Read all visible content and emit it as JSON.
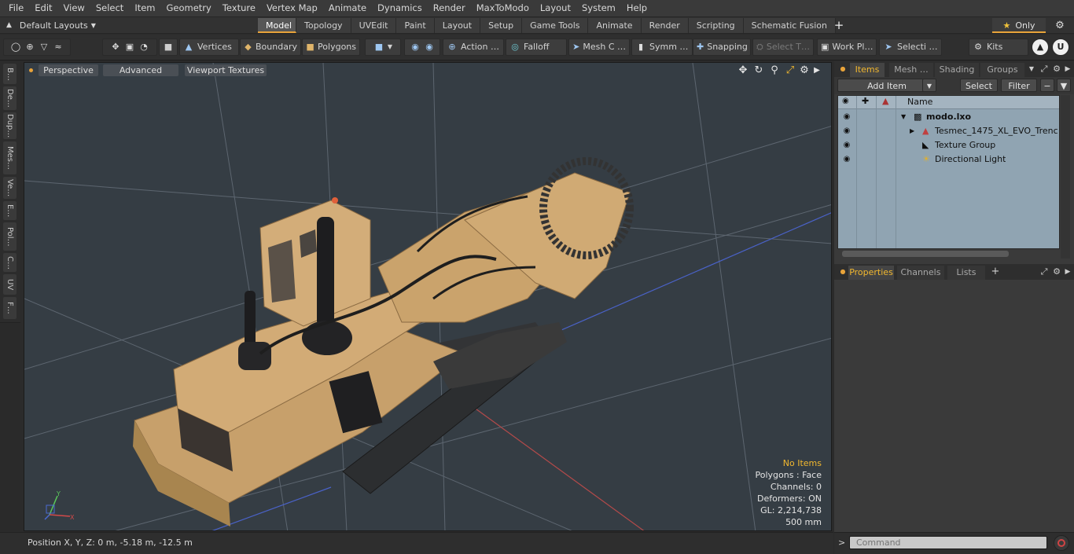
{
  "menu": [
    "File",
    "Edit",
    "View",
    "Select",
    "Item",
    "Geometry",
    "Texture",
    "Vertex Map",
    "Animate",
    "Dynamics",
    "Render",
    "MaxToModo",
    "Layout",
    "System",
    "Help"
  ],
  "layout_dropdown": "Default Layouts",
  "layout_tabs": [
    "Model",
    "Topology",
    "UVEdit",
    "Paint",
    "Layout",
    "Setup",
    "Game Tools",
    "Animate",
    "Render",
    "Scripting",
    "Schematic Fusion"
  ],
  "active_layout_tab": "Model",
  "only_label": "Only",
  "toolbar": {
    "vertices": "Vertices",
    "boundary": "Boundary",
    "polygons": "Polygons",
    "action": "Action …",
    "falloff": "Falloff",
    "mesh": "Mesh C …",
    "symmetry": "Symm …",
    "snapping": "Snapping",
    "select_t": "Select T…",
    "work_plane": "Work Pl…",
    "selection": "Selecti …",
    "kits": "Kits"
  },
  "left_tabs": [
    "B…",
    "De…",
    "Dup…",
    "Mes…",
    "Ve…",
    "E…",
    "Pol…",
    "C…",
    "UV",
    "F…"
  ],
  "viewport": {
    "perspective": "Perspective",
    "advanced": "Advanced",
    "textures": "Viewport Textures",
    "stats": {
      "selection": "No Items",
      "polygons": "Polygons : Face",
      "channels": "Channels: 0",
      "deformers": "Deformers: ON",
      "gl": "GL: 2,214,738",
      "scale": "500 mm"
    }
  },
  "status": "Position X, Y, Z:   0 m, -5.18 m, -12.5 m",
  "items_panel": {
    "tabs": [
      "Items",
      "Mesh …",
      "Shading",
      "Groups"
    ],
    "add_item": "Add Item",
    "select": "Select",
    "filter": "Filter",
    "name_header": "Name",
    "tree": [
      {
        "label": "modo.lxo",
        "bold": true
      },
      {
        "label": "Tesmec_1475_XL_EVO_Trenc…"
      },
      {
        "label": "Texture Group"
      },
      {
        "label": "Directional Light"
      }
    ]
  },
  "props_panel": {
    "tabs": [
      "Properties",
      "Channels",
      "Lists"
    ]
  },
  "command_placeholder": "Command",
  "colors": {
    "accent": "#e8a33a",
    "viewport_bg": "#353d44",
    "tree_bg": "#90a4b2",
    "highlight_text": "#f2b82f"
  }
}
